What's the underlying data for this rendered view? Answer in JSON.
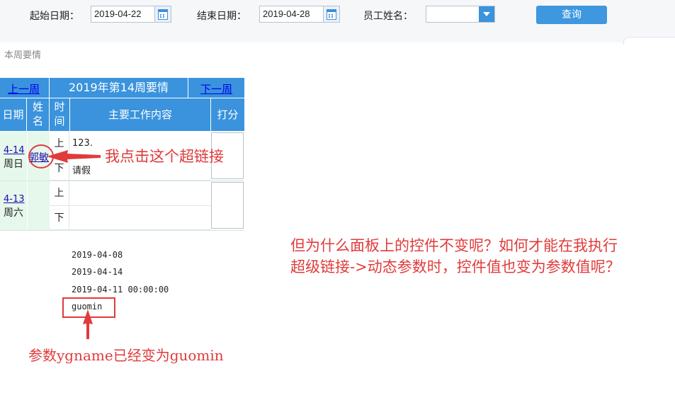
{
  "filters": {
    "start_label": "起始日期：",
    "start_value": "2019-04-22",
    "end_label": "结束日期：",
    "end_value": "2019-04-28",
    "employee_label": "员工姓名：",
    "employee_value": "",
    "query_button": "查询"
  },
  "section_label": "本周要情",
  "week_table": {
    "prev_link": "上一周",
    "title": "2019年第14周要情",
    "next_link": "下一周",
    "headers": {
      "date": "日期",
      "name": "姓名",
      "time": "时间",
      "content": "主要工作内容",
      "score": "打分"
    },
    "days": [
      {
        "date_link": "4-14",
        "weekday": "周日",
        "name_link": "郭敏",
        "am_label": "上",
        "am_content": "123.",
        "pm_label": "下",
        "pm_content": "请假"
      },
      {
        "date_link": "4-13",
        "weekday": "周六",
        "name_link": "",
        "am_label": "上",
        "am_content": "",
        "pm_label": "下",
        "pm_content": ""
      }
    ]
  },
  "debug_output": {
    "line1": "2019-04-08",
    "line2": "2019-04-14",
    "line3": "2019-04-11 00:00:00",
    "line4": "guomin"
  },
  "annotations": {
    "click_note": "我点击这个超链接",
    "question_line1": "但为什么面板上的控件不变呢？如何才能在我执行",
    "question_line2": "超级链接->动态参数时，控件值也变为参数值呢？",
    "param_note": "参数ygname已经变为guomin"
  },
  "colors": {
    "header_blue": "#3a93dc",
    "annotation_red": "#e03b3b",
    "row_green": "#e6f7ec"
  }
}
